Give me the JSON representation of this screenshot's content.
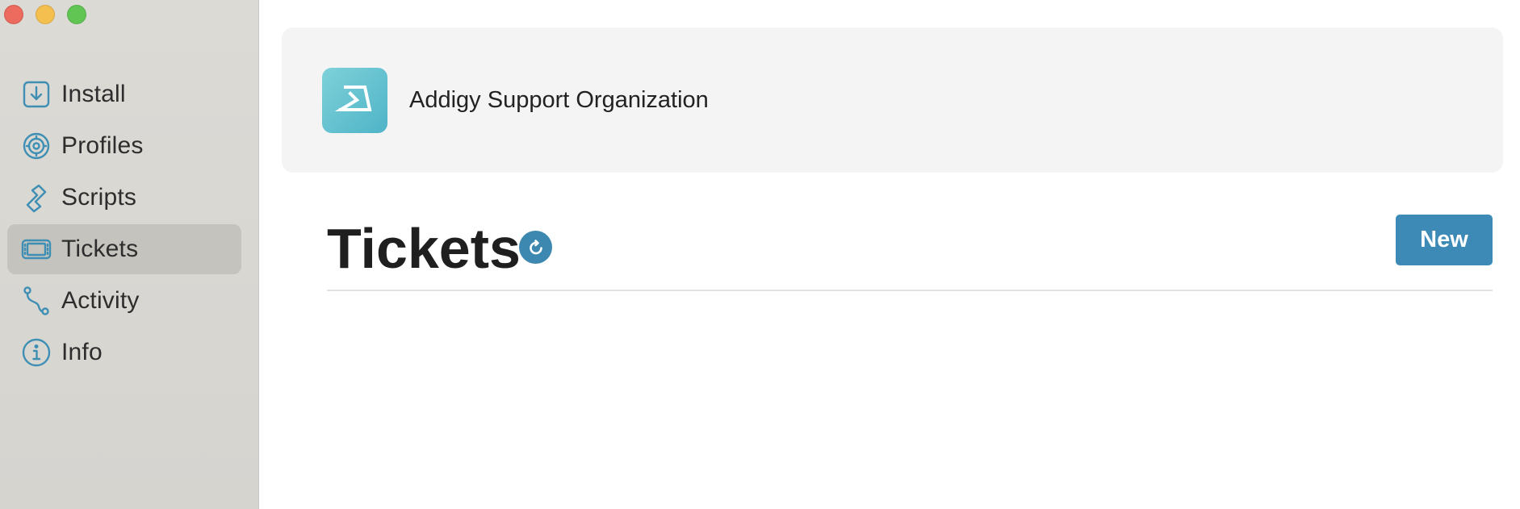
{
  "window": {
    "controls": [
      "close",
      "minimize",
      "zoom"
    ]
  },
  "sidebar": {
    "items": [
      {
        "label": "Install",
        "icon": "download-icon",
        "active": false
      },
      {
        "label": "Profiles",
        "icon": "gear-icon",
        "active": false
      },
      {
        "label": "Scripts",
        "icon": "script-icon",
        "active": false
      },
      {
        "label": "Tickets",
        "icon": "ticket-icon",
        "active": true
      },
      {
        "label": "Activity",
        "icon": "activity-icon",
        "active": false
      },
      {
        "label": "Info",
        "icon": "info-icon",
        "active": false
      }
    ]
  },
  "organization": {
    "name": "Addigy Support Organization",
    "logo_icon": "addigy-logo-icon"
  },
  "tickets": {
    "title": "Tickets",
    "refresh_icon": "refresh-icon",
    "new_label": "New"
  },
  "colors": {
    "accent": "#3d8ab6",
    "icon_stroke": "#3f8fb4",
    "logo_gradient_start": "#7ed1d9",
    "logo_gradient_end": "#4fb4c7"
  }
}
